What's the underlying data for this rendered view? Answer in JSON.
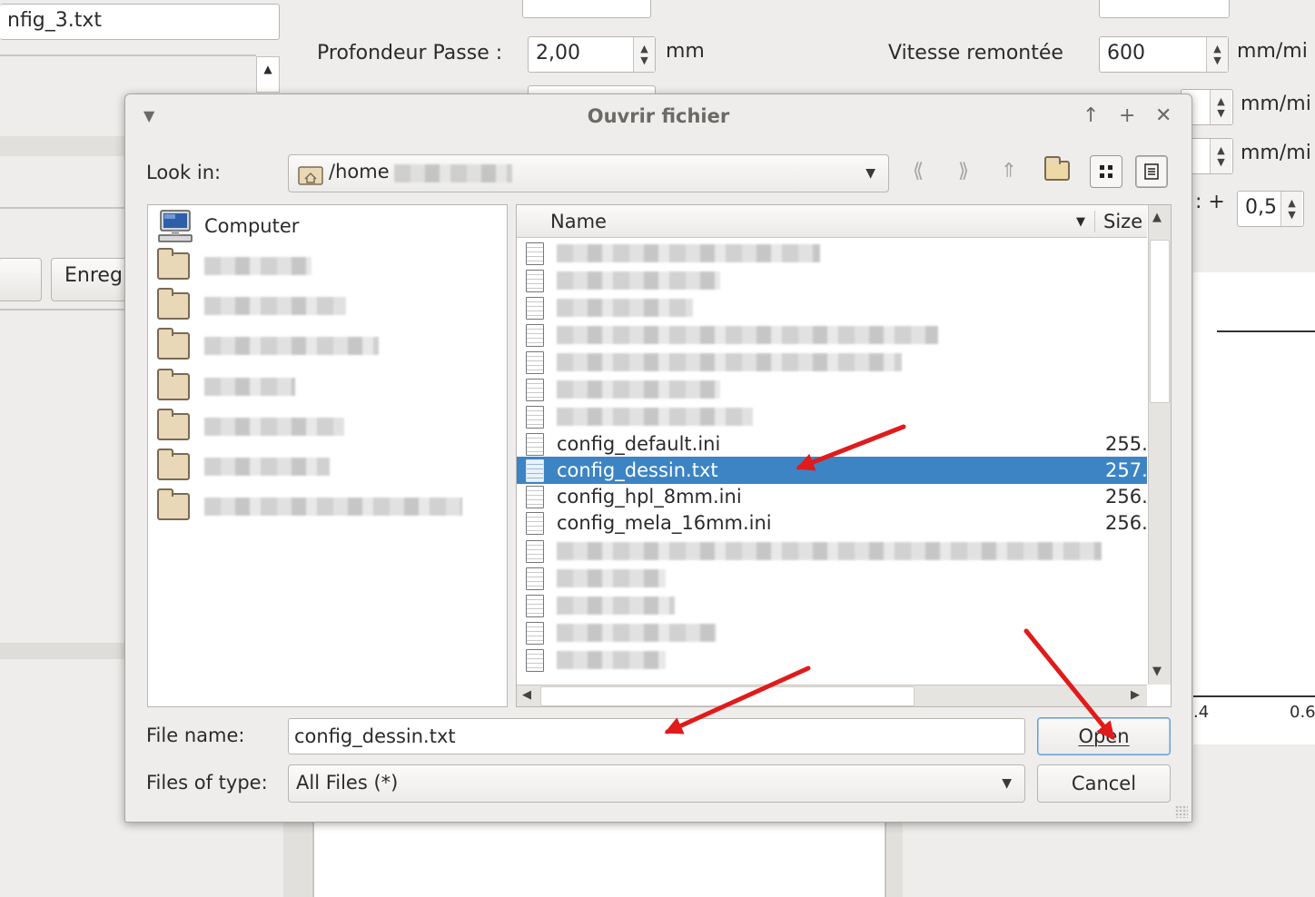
{
  "background": {
    "top_field_value": "nfig_3.txt",
    "profondeur_label": "Profondeur Passe :",
    "profondeur_value": "2,00",
    "profondeur_unit": "mm",
    "vitesse_label": "Vitesse remontée",
    "vitesse_value": "600",
    "vitesse_unit": "mm/mi",
    "unit_row2": "mm/mi",
    "unit_row3": "mm/mi",
    "plus_label": ": +",
    "small_value": "0,5",
    "save_button": "Enreg",
    "axis_tick_1": ".4",
    "axis_tick_2": "0.6"
  },
  "dialog": {
    "title": "Ouvrir fichier",
    "look_in_label": "Look in:",
    "look_in_path": "/home",
    "places": [
      {
        "label": "Computer"
      }
    ],
    "columns": {
      "name": "Name",
      "size": "Size"
    },
    "files": [
      {
        "name": "config_default.ini",
        "size": "255.",
        "selected": false
      },
      {
        "name": "config_dessin.txt",
        "size": "257.",
        "selected": true
      },
      {
        "name": "config_hpl_8mm.ini",
        "size": "256.",
        "selected": false
      },
      {
        "name": "config_mela_16mm.ini",
        "size": "256.",
        "selected": false
      }
    ],
    "file_name_label": "File name:",
    "file_name_value": "config_dessin.txt",
    "files_of_type_label": "Files of type:",
    "files_of_type_value": "All Files (*)",
    "open_button": "Open",
    "cancel_button": "Cancel"
  },
  "colors": {
    "selection": "#3d84c4",
    "annotation_arrow": "#e01b1b"
  }
}
